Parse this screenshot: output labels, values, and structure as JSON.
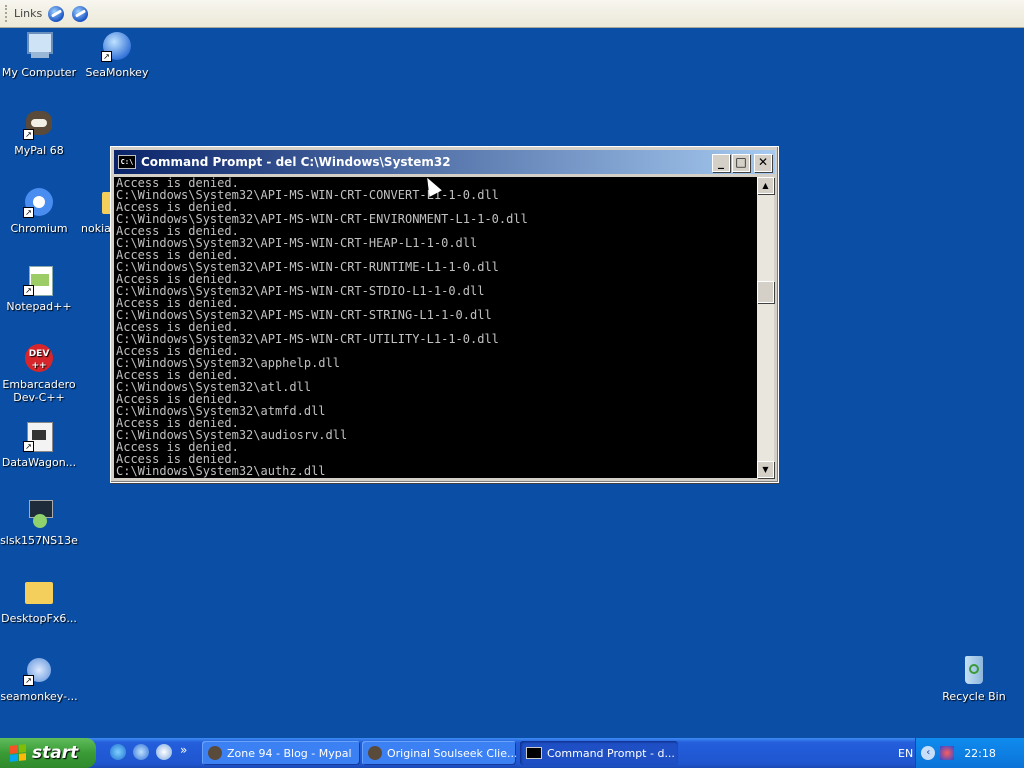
{
  "links_bar": {
    "label": "Links"
  },
  "desktop_icons": [
    {
      "label": "My Computer"
    },
    {
      "label": "SeaMonkey"
    },
    {
      "label": "MyPal 68"
    },
    {
      "label": "Chromium"
    },
    {
      "label": "nokia_"
    },
    {
      "label": "Notepad++"
    },
    {
      "label": "Embarcadero Dev-C++"
    },
    {
      "label": "DataWagon..."
    },
    {
      "label": "slsk157NS13e"
    },
    {
      "label": "DesktopFx6..."
    },
    {
      "label": "seamonkey-..."
    },
    {
      "label": "Recycle Bin"
    }
  ],
  "cmd_window": {
    "title": "Command Prompt - del C:\\Windows\\System32",
    "lines": [
      "Access is denied.",
      "C:\\Windows\\System32\\API-MS-WIN-CRT-CONVERT-L1-1-0.dll",
      "Access is denied.",
      "C:\\Windows\\System32\\API-MS-WIN-CRT-ENVIRONMENT-L1-1-0.dll",
      "Access is denied.",
      "C:\\Windows\\System32\\API-MS-WIN-CRT-HEAP-L1-1-0.dll",
      "Access is denied.",
      "C:\\Windows\\System32\\API-MS-WIN-CRT-RUNTIME-L1-1-0.dll",
      "Access is denied.",
      "C:\\Windows\\System32\\API-MS-WIN-CRT-STDIO-L1-1-0.dll",
      "Access is denied.",
      "C:\\Windows\\System32\\API-MS-WIN-CRT-STRING-L1-1-0.dll",
      "Access is denied.",
      "C:\\Windows\\System32\\API-MS-WIN-CRT-UTILITY-L1-1-0.dll",
      "Access is denied.",
      "C:\\Windows\\System32\\apphelp.dll",
      "Access is denied.",
      "C:\\Windows\\System32\\atl.dll",
      "Access is denied.",
      "C:\\Windows\\System32\\atmfd.dll",
      "Access is denied.",
      "C:\\Windows\\System32\\audiosrv.dll",
      "Access is denied.",
      "Access is denied.",
      "C:\\Windows\\System32\\authz.dll"
    ]
  },
  "taskbar": {
    "start_label": "start",
    "overflow_label": "»",
    "tasks": [
      {
        "label": "Zone 94 - Blog - Mypal"
      },
      {
        "label": "Original Soulseek Clie..."
      },
      {
        "label": "Command Prompt - d..."
      }
    ],
    "tray": {
      "language": "EN",
      "time": "22:18"
    }
  },
  "colors": {
    "desktop": "#0a4ea6",
    "taskbar": "#245edb",
    "start": "#3a9b36"
  }
}
